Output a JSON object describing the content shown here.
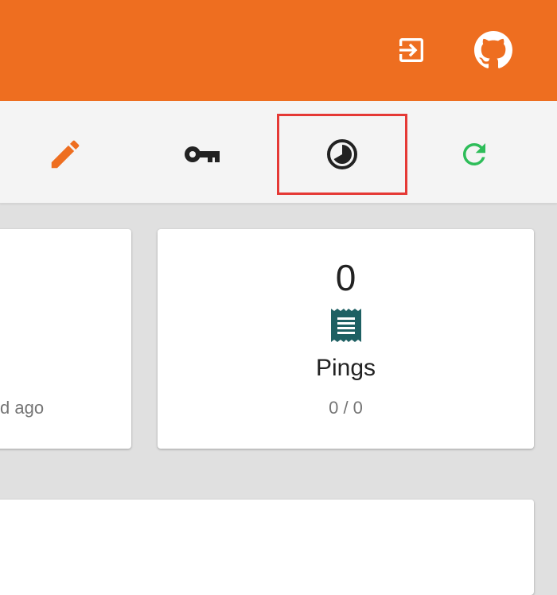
{
  "header": {
    "background": "#ee6e20",
    "icons": [
      {
        "name": "login-icon",
        "color": "#ffffff"
      },
      {
        "name": "github-icon",
        "color": "#ffffff"
      }
    ]
  },
  "toolbar": {
    "background": "#f4f4f4",
    "tools": [
      {
        "name": "pencil-icon",
        "color": "#ee6e20"
      },
      {
        "name": "key-icon",
        "color": "#222222"
      },
      {
        "name": "pie-timer-icon",
        "color": "#222222",
        "highlighted": true,
        "highlight_color": "#e53935"
      },
      {
        "name": "refresh-icon",
        "color": "#2ebd59"
      }
    ]
  },
  "cards": {
    "left": {
      "sub_text": "d ago"
    },
    "pings": {
      "value": "0",
      "icon": "receipt-icon",
      "icon_color": "#1e6063",
      "label": "Pings",
      "sub_text": "0 / 0"
    }
  }
}
